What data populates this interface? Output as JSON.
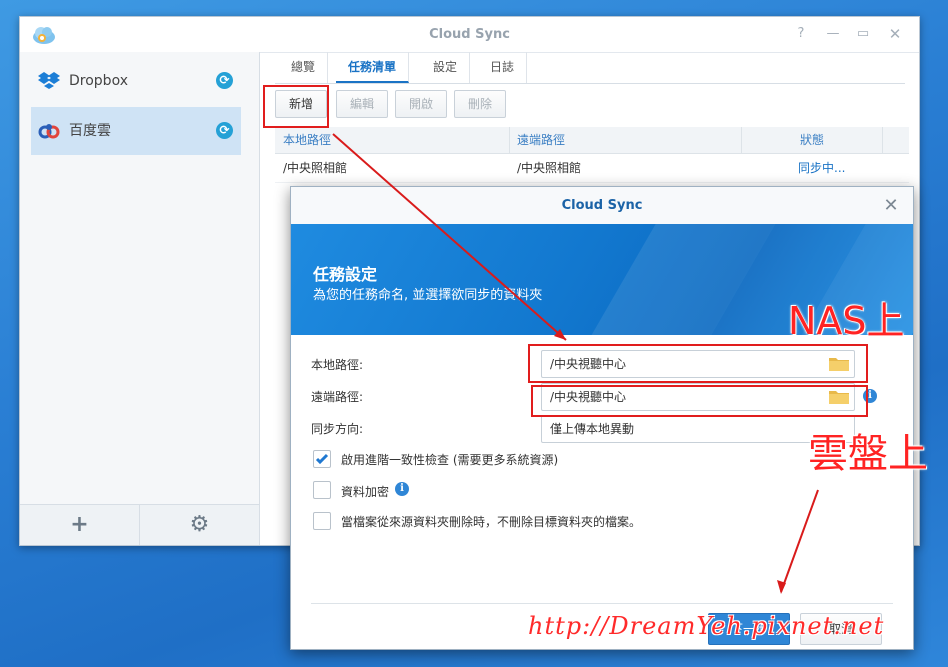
{
  "window": {
    "title": "Cloud Sync",
    "controls": [
      "help-icon",
      "minimize-icon",
      "maximize-icon",
      "close-icon"
    ]
  },
  "sidebar": {
    "items": [
      {
        "label": "Dropbox",
        "icon": "dropbox-icon",
        "status_icon": "sync-icon",
        "active": false
      },
      {
        "label": "百度雲",
        "icon": "baidu-cloud-icon",
        "status_icon": "sync-icon",
        "active": true
      }
    ],
    "footer": {
      "add_icon": "plus-icon",
      "settings_icon": "gear-icon"
    }
  },
  "tabs": [
    {
      "label": "總覽",
      "active": false
    },
    {
      "label": "任務清單",
      "active": true
    },
    {
      "label": "設定",
      "active": false
    },
    {
      "label": "日誌",
      "active": false
    }
  ],
  "toolbar": {
    "new_label": "新增",
    "edit_label": "編輯",
    "start_label": "開啟",
    "delete_label": "刪除"
  },
  "table": {
    "headers": [
      "本地路徑",
      "遠端路徑",
      "狀態"
    ],
    "rows": [
      [
        "/中央照相館",
        "/中央照相館",
        "同步中..."
      ]
    ]
  },
  "dialog": {
    "title": "Cloud Sync",
    "banner_title": "任務設定",
    "banner_subtitle": "為您的任務命名, 並選擇欲同步的資料夾",
    "local_path_label": "本地路徑:",
    "local_path_value": "/中央視聽中心",
    "remote_path_label": "遠端路徑:",
    "remote_path_value": "/中央視聽中心",
    "direction_label": "同步方向:",
    "direction_value": "僅上傳本地異動",
    "checkbox_consistency": {
      "label": "啟用進階一致性檢查 (需要更多系統資源)",
      "checked": true
    },
    "checkbox_encrypt": {
      "label": "資料加密",
      "checked": false
    },
    "checkbox_keep": {
      "label": "當檔案從來源資料夾刪除時，不刪除目標資料夾的檔案。",
      "checked": false
    },
    "next_label": "下一步",
    "cancel_label": "取消"
  },
  "annotations": {
    "nas_label": "NAS上",
    "cloud_label": "雲盤上",
    "watermark": "http://DreamYeh.pixnet.net",
    "color": "#e11d1d"
  },
  "colors": {
    "accent": "#1a73c5",
    "banner": "#1278cf",
    "annotation": "#e11d1d"
  }
}
